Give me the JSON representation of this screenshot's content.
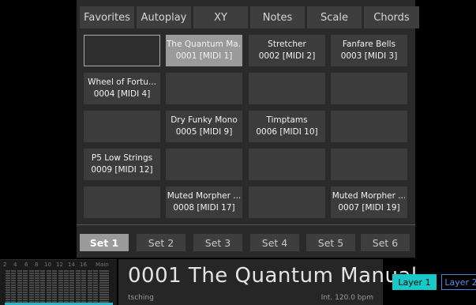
{
  "tabs": [
    {
      "label": "Favorites",
      "active": true
    },
    {
      "label": "Autoplay",
      "active": false
    },
    {
      "label": "XY",
      "active": false
    },
    {
      "label": "Notes",
      "active": false
    },
    {
      "label": "Scale",
      "active": false
    },
    {
      "label": "Chords",
      "active": false
    }
  ],
  "grid": [
    [
      {
        "name": "",
        "number": "",
        "state": "outline"
      },
      {
        "name": "The Quantum Ma...",
        "number": "0001 [MIDI 1]",
        "state": "selected"
      },
      {
        "name": "Stretcher",
        "number": "0002 [MIDI 2]",
        "state": "normal"
      },
      {
        "name": "Fanfare Bells",
        "number": "0003 [MIDI 3]",
        "state": "normal"
      }
    ],
    [
      {
        "name": "Wheel of Fortu...",
        "number": "0004 [MIDI 4]",
        "state": "normal"
      },
      {
        "name": "",
        "number": "",
        "state": "normal"
      },
      {
        "name": "",
        "number": "",
        "state": "normal"
      },
      {
        "name": "",
        "number": "",
        "state": "normal"
      }
    ],
    [
      {
        "name": "",
        "number": "",
        "state": "normal"
      },
      {
        "name": "Dry Funky Mono",
        "number": "0005 [MIDI 9]",
        "state": "normal"
      },
      {
        "name": "Timptams",
        "number": "0006 [MIDI 10]",
        "state": "normal"
      },
      {
        "name": "",
        "number": "",
        "state": "normal"
      }
    ],
    [
      {
        "name": "P5 Low Strings",
        "number": "0009 [MIDI 12]",
        "state": "normal"
      },
      {
        "name": "",
        "number": "",
        "state": "normal"
      },
      {
        "name": "",
        "number": "",
        "state": "normal"
      },
      {
        "name": "",
        "number": "",
        "state": "normal"
      }
    ],
    [
      {
        "name": "",
        "number": "",
        "state": "normal"
      },
      {
        "name": "Muted Morpher ...",
        "number": "0008 [MIDI 17]",
        "state": "normal"
      },
      {
        "name": "",
        "number": "",
        "state": "normal"
      },
      {
        "name": "Muted Morpher ...",
        "number": "0007 [MIDI 19]",
        "state": "normal"
      }
    ]
  ],
  "sets": [
    {
      "label": "Set 1",
      "active": true
    },
    {
      "label": "Set 2",
      "active": false
    },
    {
      "label": "Set 3",
      "active": false
    },
    {
      "label": "Set 4",
      "active": false
    },
    {
      "label": "Set 5",
      "active": false
    },
    {
      "label": "Set 6",
      "active": false
    }
  ],
  "meter": {
    "labels": [
      "2",
      "4",
      "6",
      "8",
      "10",
      "12",
      "14",
      "16",
      "Main"
    ]
  },
  "display": {
    "title": "0001 The Quantum Manual",
    "author": "tsching",
    "tempo": "Int. 120.0 bpm"
  },
  "layers": {
    "layer1": "Layer 1",
    "layer2": "Layer 2"
  },
  "colors": {
    "layer_active": "#18c9c9",
    "layer_inactive_text": "#5a8df0",
    "meter_base": "#25b6c8"
  }
}
